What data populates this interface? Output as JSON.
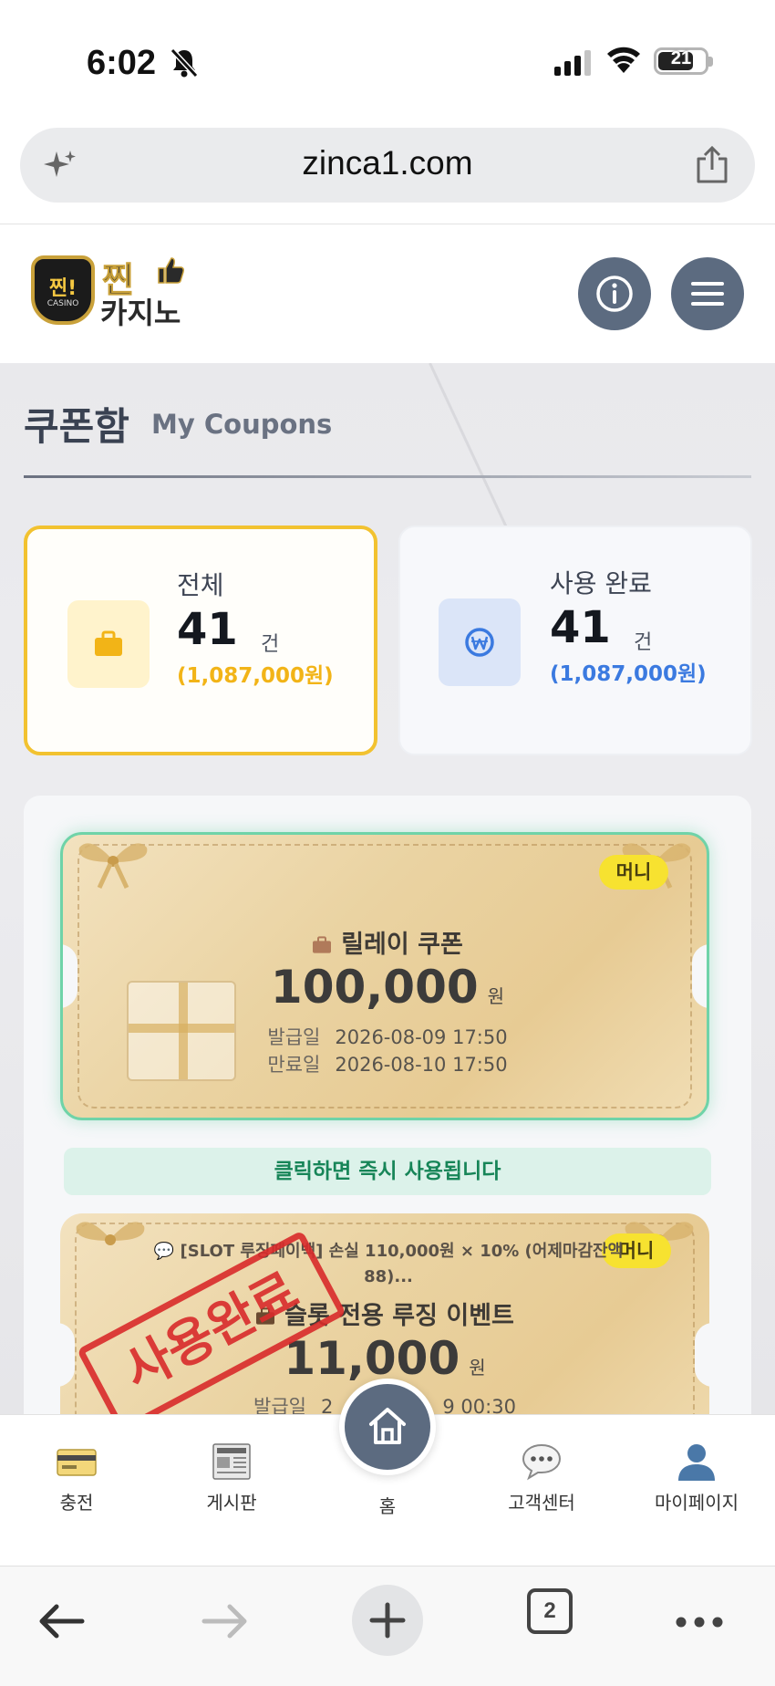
{
  "status_bar": {
    "time": "6:02",
    "battery": "21"
  },
  "browser": {
    "url": "zinca1.com",
    "tab_count": "2"
  },
  "header": {
    "logo_badge": "찐!",
    "logo_badge_sub": "CASINO",
    "logo_line1": "찐",
    "logo_line2": "카지노"
  },
  "page": {
    "title": "쿠폰함",
    "subtitle": "My Coupons"
  },
  "stats": {
    "total": {
      "label": "전체",
      "count": "41",
      "unit": "건",
      "amount": "(1,087,000원)",
      "color": "#f2b417"
    },
    "used": {
      "label": "사용 완료",
      "count": "41",
      "unit": "건",
      "amount": "(1,087,000원)",
      "color": "#3b7ae0"
    }
  },
  "coupons": [
    {
      "badge": "머니",
      "name": "릴레이 쿠폰",
      "amount": "100,000",
      "unit": "원",
      "issued_label": "발급일",
      "issued": "2026-08-09 17:50",
      "expires_label": "만료일",
      "expires": "2026-08-10 17:50",
      "hint": "클릭하면 즉시 사용됩니다"
    },
    {
      "badge": "머니",
      "promo": "💬 [SLOT 루징페이백] 손실 110,000원 × 10% (어제마감잔액 88)...",
      "name": "슬롯 전용 루징 이벤트",
      "amount": "11,000",
      "unit": "원",
      "issued_label": "발급일",
      "issued_partial": "2",
      "issued_partial_end": "9 00:30",
      "stamp": "사용완료"
    }
  ],
  "bottom_nav": {
    "items": [
      {
        "label": "충전",
        "icon": "credit-card-icon"
      },
      {
        "label": "게시판",
        "icon": "newspaper-icon"
      },
      {
        "label": "홈",
        "icon": "home-icon"
      },
      {
        "label": "고객센터",
        "icon": "speech-bubble-icon"
      },
      {
        "label": "마이페이지",
        "icon": "user-icon"
      }
    ]
  },
  "colors": {
    "accent_slate": "#5c6b80",
    "gold": "#f2c230",
    "green": "#178558",
    "stamp_red": "#d92b2b"
  }
}
